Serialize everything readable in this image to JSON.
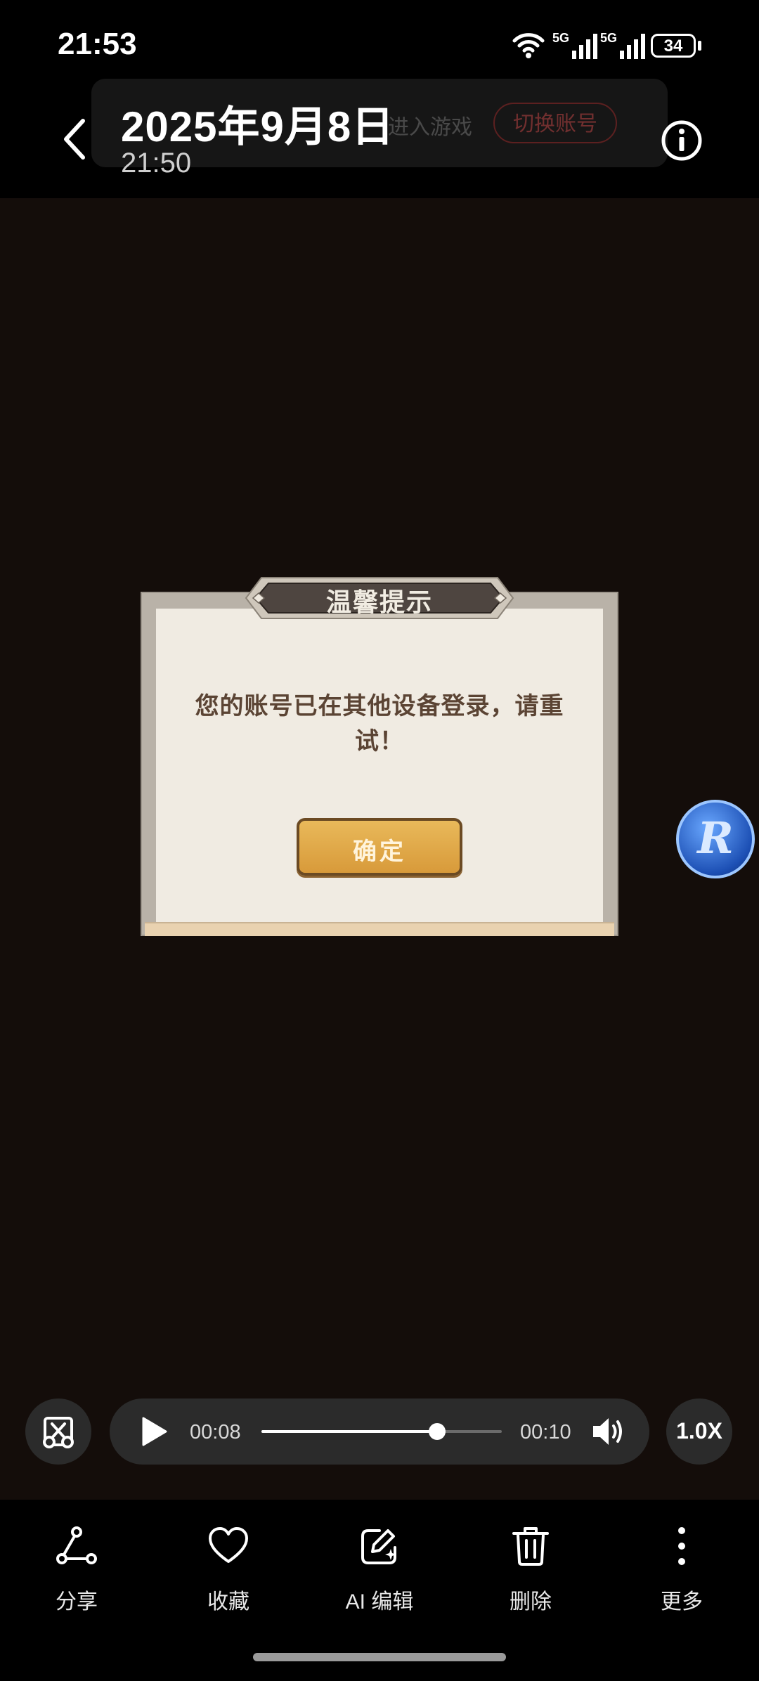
{
  "status_bar": {
    "time": "21:53",
    "signal_1_label": "5G",
    "signal_2_label": "5G",
    "battery": "34"
  },
  "header": {
    "date": "2025年9月8日",
    "time": "21:50",
    "ghost_enter_game": "进入游戏",
    "ghost_switch_account": "切换账号"
  },
  "dialog": {
    "title": "温馨提示",
    "message": "您的账号已在其他设备登录，请重试！",
    "confirm_label": "确定"
  },
  "floating_button": {
    "letter": "R"
  },
  "player": {
    "current_time": "00:08",
    "total_time": "00:10",
    "progress": 0.73,
    "speed": "1.0X"
  },
  "actions": [
    {
      "label": "分享",
      "icon": "share-icon"
    },
    {
      "label": "收藏",
      "icon": "heart-icon"
    },
    {
      "label": "AI 编辑",
      "icon": "ai-edit-icon"
    },
    {
      "label": "删除",
      "icon": "trash-icon"
    },
    {
      "label": "更多",
      "icon": "more-icon"
    }
  ]
}
